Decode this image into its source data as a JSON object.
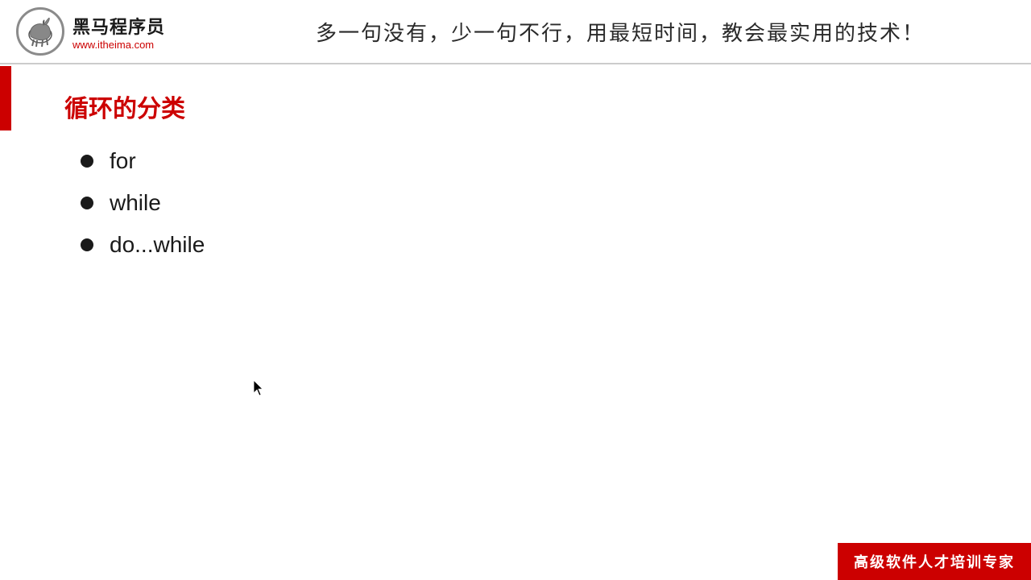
{
  "header": {
    "logo_name": "黑马程序员",
    "logo_url": "www.itheima.com",
    "slogan": "多一句没有，少一句不行，用最短时间，教会最实用的技术！"
  },
  "main": {
    "section_title": "循环的分类",
    "bullet_items": [
      {
        "label": "for"
      },
      {
        "label": "while"
      },
      {
        "label": "do...while"
      }
    ]
  },
  "footer": {
    "label": "高级软件人才培训专家"
  }
}
